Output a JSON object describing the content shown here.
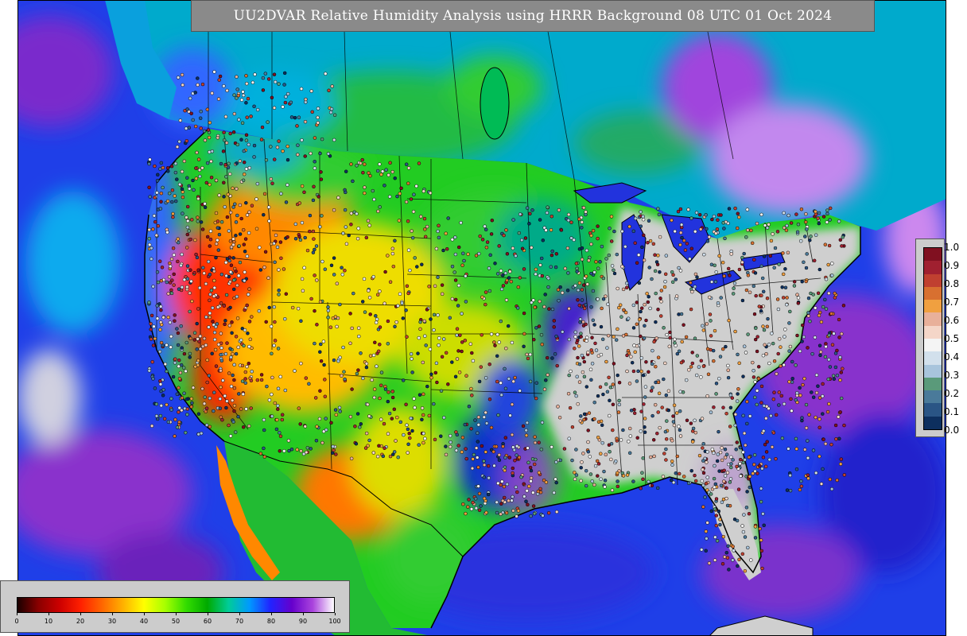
{
  "title": "UU2DVAR Relative Humidity Analysis using HRRR Background 08 UTC 01 Oct 2024",
  "rh_colorbar": {
    "ticks": [
      "0",
      "10",
      "20",
      "30",
      "40",
      "50",
      "60",
      "70",
      "80",
      "90",
      "100"
    ],
    "colors": [
      "#1a0000",
      "#8b0000",
      "#cc0000",
      "#ff2000",
      "#ff6600",
      "#ffb000",
      "#ffff00",
      "#a6ff00",
      "#33dd00",
      "#00aa00",
      "#00cc99",
      "#0099ff",
      "#2222ff",
      "#6600cc",
      "#aa44dd",
      "#ffffff"
    ]
  },
  "obs_colorbar": {
    "ticks": [
      "0.0",
      "0.1",
      "0.2",
      "0.3",
      "0.4",
      "0.5",
      "0.6",
      "0.7",
      "0.8",
      "0.9",
      "1.0"
    ],
    "colors": [
      "#0d2f5e",
      "#2a5585",
      "#4a7a9a",
      "#5a9a7a",
      "#a8c4dc",
      "#d2e0ec",
      "#f4f4f4",
      "#f4d6c8",
      "#e8b09a",
      "#f0a040",
      "#d87030",
      "#c04030",
      "#a02030",
      "#801020"
    ]
  },
  "map_colors": {
    "ocean_blue": "#1a44ff",
    "ocean_deep": "#2a2acc",
    "purple": "#8822cc",
    "cyan": "#00aaee",
    "green": "#22cc22",
    "yellow": "#eeee22",
    "orange": "#ff9900",
    "red": "#ff2200",
    "saturated": "#d0d0d0",
    "border": "#000000"
  }
}
